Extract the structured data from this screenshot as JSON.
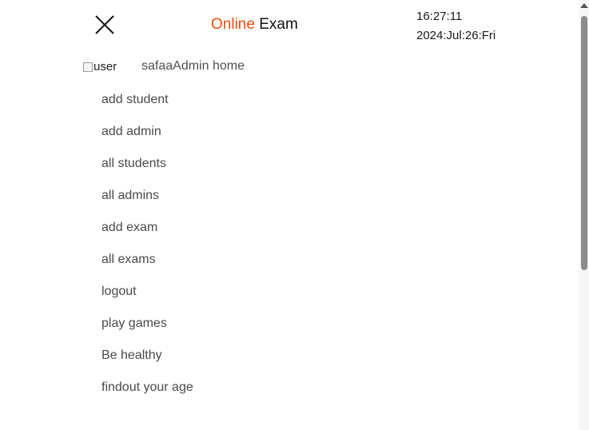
{
  "header": {
    "brand_accent": "Online",
    "brand_rest": " Exam",
    "accent_color": "#ee4b12",
    "close_icon": "close-icon"
  },
  "clock": {
    "time": "16:27:11",
    "date": "2024:Jul:26:Fri"
  },
  "user": {
    "image_alt": "user",
    "label": "safaaAdmin home"
  },
  "menu": {
    "items": [
      {
        "label": "add student"
      },
      {
        "label": "add admin"
      },
      {
        "label": "all students"
      },
      {
        "label": "all admins"
      },
      {
        "label": "add exam"
      },
      {
        "label": "all exams"
      },
      {
        "label": "logout"
      },
      {
        "label": "play games"
      },
      {
        "label": "Be healthy"
      },
      {
        "label": "findout your age"
      }
    ]
  }
}
